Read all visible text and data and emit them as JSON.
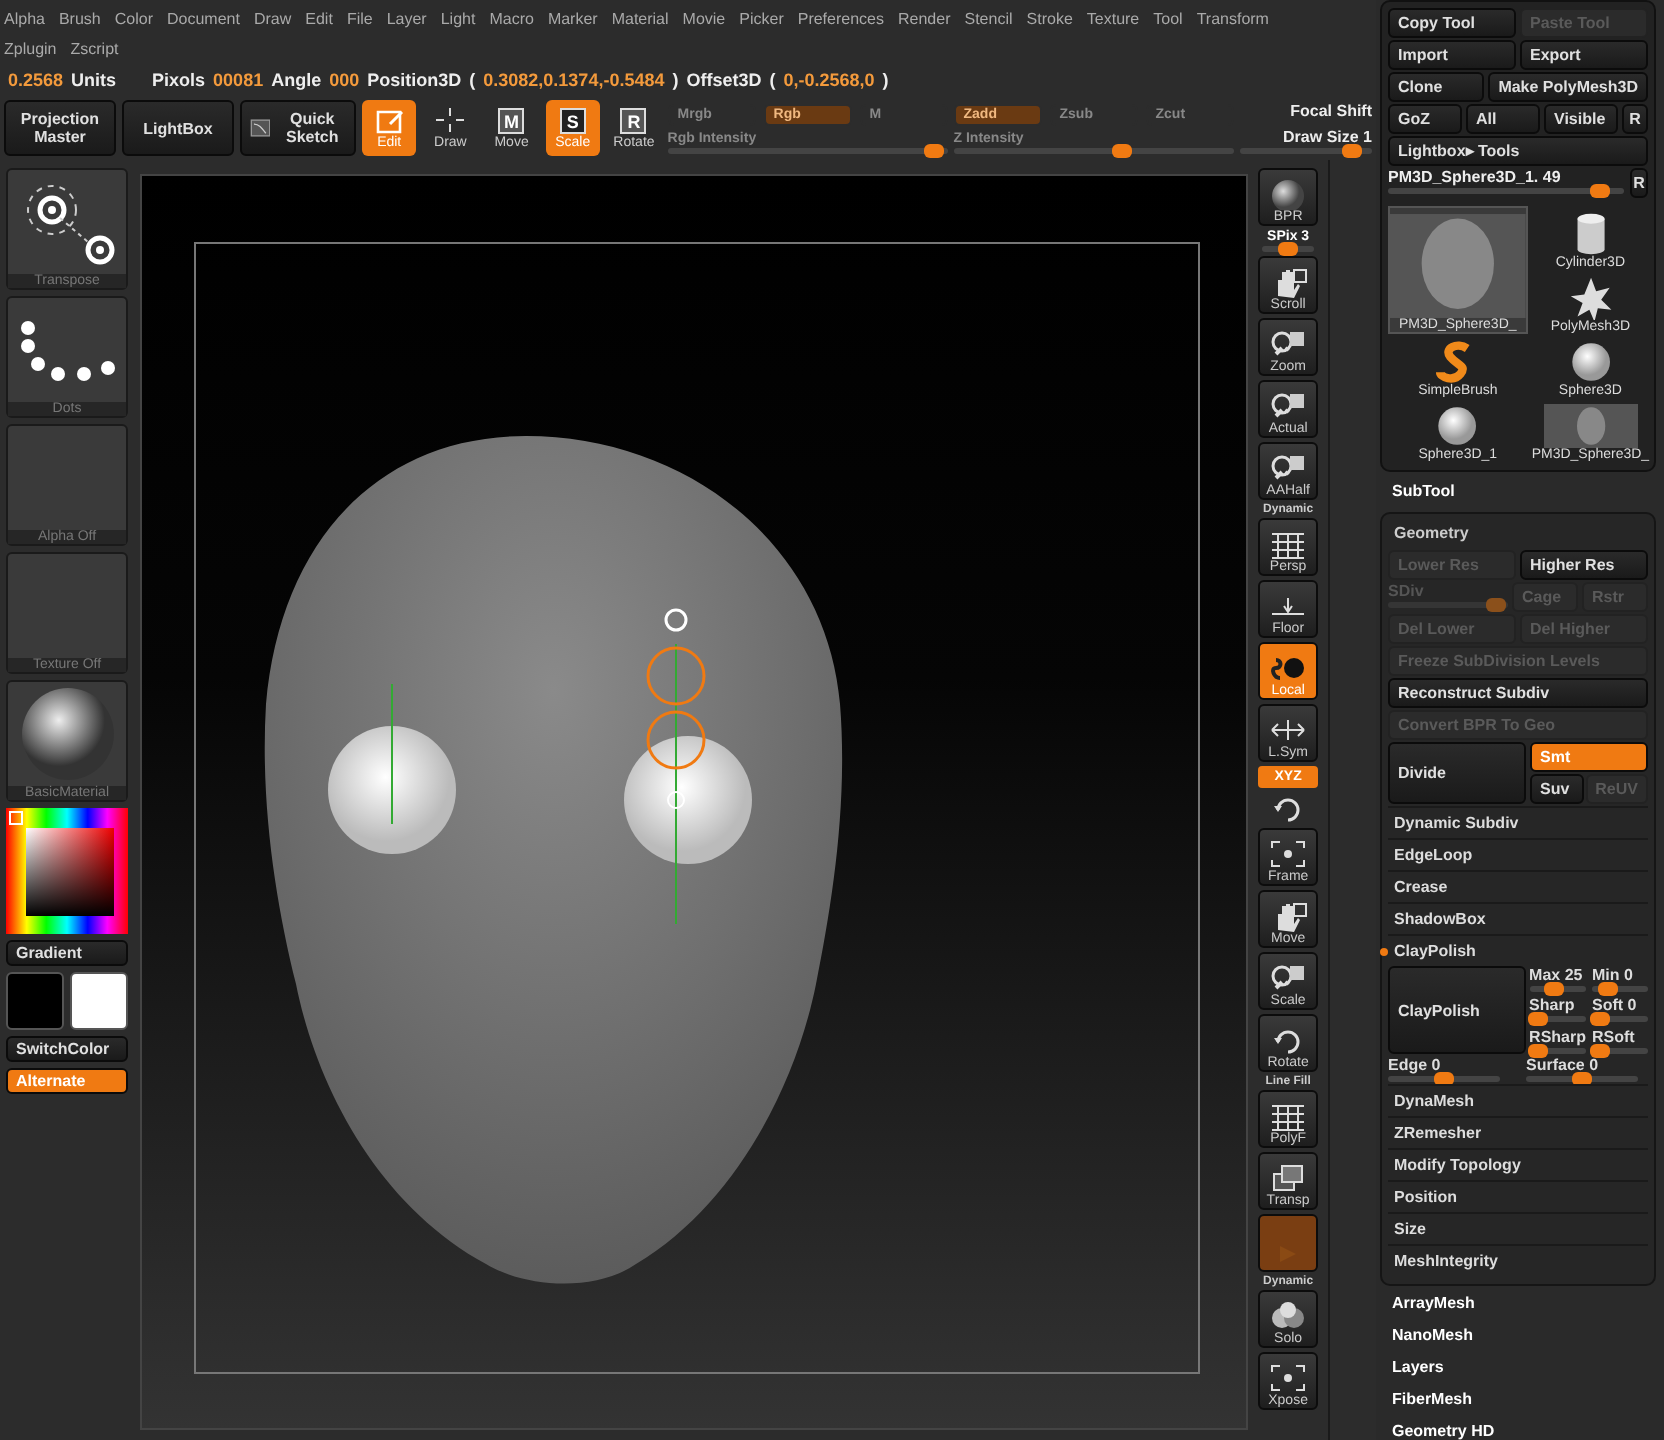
{
  "menu": [
    "Alpha",
    "Brush",
    "Color",
    "Document",
    "Draw",
    "Edit",
    "File",
    "Layer",
    "Light",
    "Macro",
    "Marker",
    "Material",
    "Movie",
    "Picker",
    "Preferences",
    "Render",
    "Stencil",
    "Stroke",
    "Texture",
    "Tool",
    "Transform"
  ],
  "menu_row2": [
    "Zplugin",
    "Zscript"
  ],
  "status": [
    {
      "text": "0.2568",
      "kind": "value"
    },
    {
      "text": "Units",
      "kind": "label"
    },
    {
      "text": "Pixols",
      "kind": "label"
    },
    {
      "text": "00081",
      "kind": "value"
    },
    {
      "text": "Angle",
      "kind": "label"
    },
    {
      "text": "000",
      "kind": "value"
    },
    {
      "text": "Position3D",
      "kind": "label"
    },
    {
      "text": "(",
      "kind": "label"
    },
    {
      "text": "0.3082,0.1374,-0.5484",
      "kind": "value"
    },
    {
      "text": ")",
      "kind": "label"
    },
    {
      "text": "Offset3D",
      "kind": "label"
    },
    {
      "text": "(",
      "kind": "label"
    },
    {
      "text": "0,-0.2568,0",
      "kind": "value"
    },
    {
      "text": ")",
      "kind": "label"
    }
  ],
  "toolbar": {
    "big_buttons": [
      "Projection Master",
      "LightBox",
      "Quick Sketch"
    ],
    "modes": [
      {
        "label": "Edit",
        "selected": true
      },
      {
        "label": "Draw",
        "selected": false
      },
      {
        "label": "Move",
        "glyph": "M",
        "selected": false
      },
      {
        "label": "Scale",
        "glyph": "S",
        "selected": true
      },
      {
        "label": "Rotate",
        "glyph": "R",
        "selected": false
      }
    ],
    "rgb_group": [
      {
        "label": "Mrgb",
        "selected": false
      },
      {
        "label": "Rgb",
        "selected": true
      },
      {
        "label": "M",
        "selected": false
      }
    ],
    "rgb_intensity": {
      "label": "Rgb Intensity",
      "level": 0.95
    },
    "z_group": [
      {
        "label": "Zadd",
        "selected": true
      },
      {
        "label": "Zsub",
        "selected": false
      },
      {
        "label": "Zcut",
        "selected": false
      }
    ],
    "z_intensity": {
      "label": "Z Intensity",
      "level": 0.6
    },
    "focal_shift": {
      "label": "Focal Shift"
    },
    "draw_size": {
      "label": "Draw Size",
      "value": "1",
      "level": 0.85
    }
  },
  "left_tiles": [
    {
      "label": "Transpose"
    },
    {
      "label": "Dots"
    },
    {
      "label": "Alpha Off"
    },
    {
      "label": "Texture Off"
    },
    {
      "label": "BasicMaterial"
    }
  ],
  "color": {
    "gradient_label": "Gradient",
    "switch_label": "SwitchColor",
    "alternate": {
      "label": "Alternate",
      "on": true
    }
  },
  "shelf": [
    {
      "kind": "tile",
      "label": "BPR",
      "selected": false
    },
    {
      "kind": "slider",
      "label": "SPix 3",
      "level": 0.5
    },
    {
      "kind": "tile",
      "label": "Scroll",
      "selected": false
    },
    {
      "kind": "tile",
      "label": "Zoom",
      "selected": false
    },
    {
      "kind": "tile",
      "label": "Actual",
      "selected": false
    },
    {
      "kind": "tile",
      "label": "AAHalf",
      "selected": false
    },
    {
      "kind": "tile",
      "label": "Persp",
      "caption": "Dynamic",
      "selected": false
    },
    {
      "kind": "tile",
      "label": "Floor",
      "selected": false
    },
    {
      "kind": "tile",
      "label": "Local",
      "selected": true
    },
    {
      "kind": "tile",
      "label": "L.Sym",
      "selected": false
    },
    {
      "kind": "pill",
      "label": "XYZ",
      "selected": true
    },
    {
      "kind": "mini"
    },
    {
      "kind": "tile",
      "label": "Frame",
      "selected": false
    },
    {
      "kind": "tile",
      "label": "Move",
      "selected": false
    },
    {
      "kind": "tile",
      "label": "Scale",
      "selected": false
    },
    {
      "kind": "tile",
      "label": "Rotate",
      "selected": false
    },
    {
      "kind": "tile",
      "label": "PolyF",
      "caption": "Line Fill",
      "selected": false
    },
    {
      "kind": "tile",
      "label": "Transp",
      "selected": false
    },
    {
      "kind": "tile",
      "selected": true
    },
    {
      "kind": "tile",
      "label": "Solo",
      "caption": "Dynamic",
      "selected": false
    },
    {
      "kind": "tile",
      "label": "Xpose",
      "selected": false
    }
  ],
  "tool": {
    "rows": [
      [
        {
          "label": "Copy Tool",
          "disabled": false
        },
        {
          "label": "Paste Tool",
          "disabled": true
        }
      ],
      [
        {
          "label": "Import",
          "disabled": false
        },
        {
          "label": "Export",
          "disabled": false
        }
      ],
      [
        {
          "label": "Clone",
          "disabled": false
        },
        {
          "label": "Make PolyMesh3D",
          "disabled": false
        }
      ],
      [
        {
          "label": "GoZ",
          "disabled": false
        },
        {
          "label": "All",
          "disabled": false
        },
        {
          "label": "Visible",
          "disabled": false
        },
        {
          "label": "R",
          "disabled": false
        }
      ],
      [
        {
          "label": "Lightbox▸ Tools",
          "disabled": false
        }
      ]
    ],
    "current": {
      "label": "PM3D_Sphere3D_1. 49",
      "level": 0.9,
      "reset": "R"
    },
    "thumbs": [
      {
        "label": "Cylinder3D",
        "selected": false
      },
      {
        "label": "PM3D_Sphere3D_",
        "selected": true
      },
      {
        "label": "PolyMesh3D",
        "selected": false
      },
      {
        "label": "SimpleBrush",
        "selected": false
      },
      {
        "label": "Sphere3D",
        "selected": false
      },
      {
        "label": "Sphere3D_1",
        "selected": false
      },
      {
        "label": "PM3D_Sphere3D_",
        "selected": false
      }
    ]
  },
  "subtool": "SubTool",
  "geometry": {
    "title": "Geometry",
    "rows": [
      {
        "kind": "buttons",
        "items": [
          {
            "label": "Lower Res",
            "disabled": true
          },
          {
            "label": "Higher Res",
            "disabled": false
          }
        ]
      },
      {
        "kind": "sdiv",
        "slider": {
          "label": "SDiv",
          "level": 0.9,
          "disabled": true
        },
        "items": [
          {
            "label": "Cage",
            "disabled": true
          },
          {
            "label": "Rstr",
            "disabled": true
          }
        ]
      },
      {
        "kind": "buttons",
        "items": [
          {
            "label": "Del Lower",
            "disabled": true
          },
          {
            "label": "Del Higher",
            "disabled": true
          }
        ]
      },
      {
        "kind": "buttons",
        "items": [
          {
            "label": "Freeze SubDivision Levels",
            "disabled": true
          }
        ]
      },
      {
        "kind": "buttons",
        "items": [
          {
            "label": "Reconstruct Subdiv",
            "disabled": false
          }
        ]
      },
      {
        "kind": "buttons",
        "items": [
          {
            "label": "Convert BPR To Geo",
            "disabled": true
          }
        ]
      },
      {
        "kind": "divide",
        "main": "Divide",
        "toggles": [
          {
            "label": "Smt",
            "on": true,
            "disabled": false
          },
          {
            "label": "Suv",
            "on": false,
            "disabled": false
          },
          {
            "label": "ReUV",
            "on": false,
            "disabled": true
          }
        ]
      }
    ],
    "sections": [
      {
        "label": "Dynamic Subdiv",
        "on": false
      },
      {
        "label": "EdgeLoop",
        "on": false
      },
      {
        "label": "Crease",
        "on": false
      },
      {
        "label": "ShadowBox",
        "on": false
      },
      {
        "label": "ClayPolish",
        "on": true
      }
    ],
    "claypolish": {
      "button": "ClayPolish",
      "sliders": [
        {
          "label": "Max 25",
          "level": 0.45
        },
        {
          "label": "Min 0",
          "level": 0.3
        },
        {
          "label": "Sharp",
          "level": 0.15
        },
        {
          "label": "Soft 0",
          "level": 0.15
        },
        {
          "label": "RSharp",
          "level": 0.15
        },
        {
          "label": "RSoft",
          "level": 0.15
        }
      ],
      "wide_sliders": [
        {
          "label": "Edge 0",
          "level": 0.5
        },
        {
          "label": "Surface 0",
          "level": 0.5
        }
      ]
    },
    "sections_after": [
      "DynaMesh",
      "ZRemesher",
      "Modify Topology",
      "Position",
      "Size",
      "MeshIntegrity"
    ]
  },
  "panels_after": [
    "ArrayMesh",
    "NanoMesh",
    "Layers",
    "FiberMesh",
    "Geometry HD"
  ]
}
